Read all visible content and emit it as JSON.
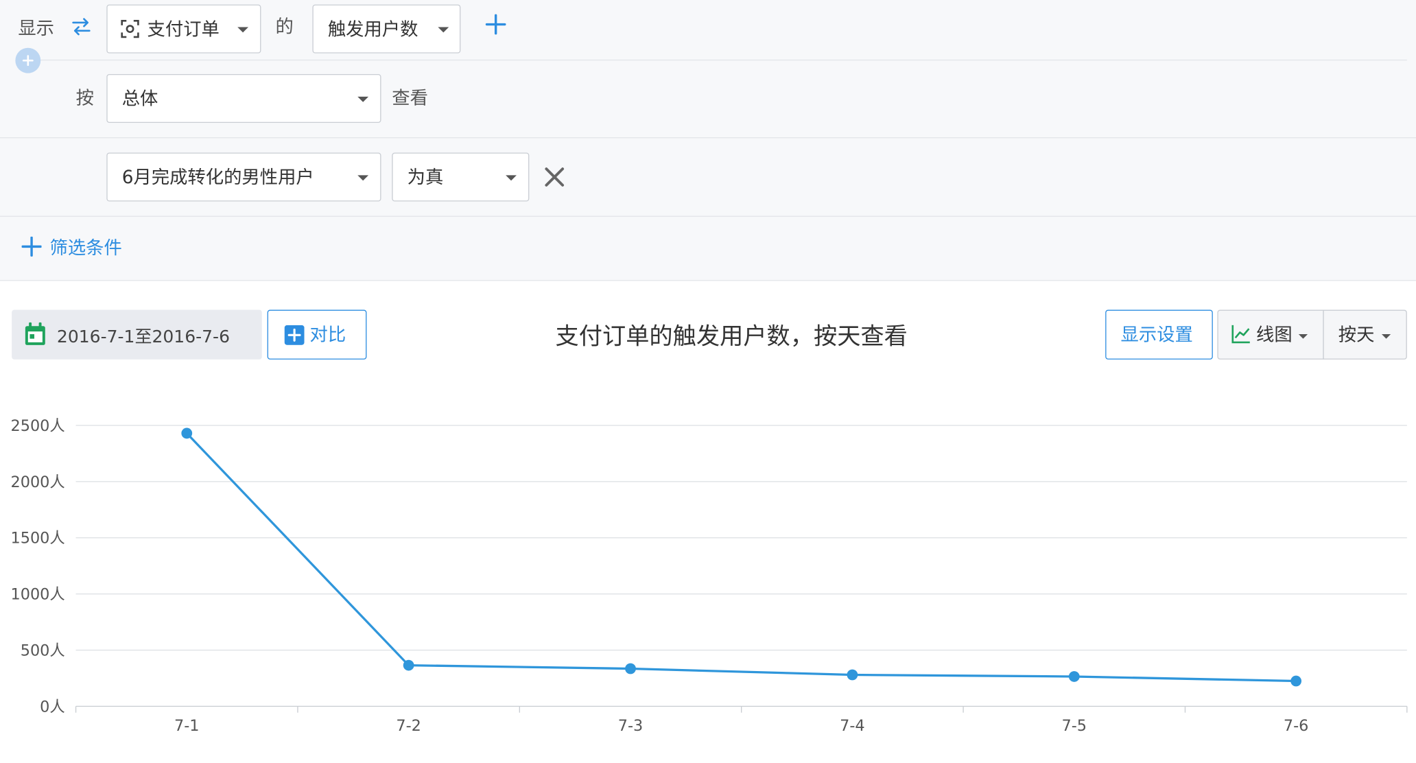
{
  "query": {
    "show_label": "显示",
    "event_select": "支付订单",
    "of_label": "的",
    "metric_select": "触发用户数",
    "by_label": "按",
    "group_select": "总体",
    "view_label": "查看"
  },
  "filter": {
    "condition_select": "6月完成转化的男性用户",
    "value_select": "为真",
    "add_filter_label": "筛选条件"
  },
  "toolbar": {
    "date_range": "2016-7-1至2016-7-6",
    "compare_label": "对比",
    "display_settings_label": "显示设置",
    "chart_type_label": "线图",
    "granularity_label": "按天"
  },
  "colors": {
    "accent": "#2d8de0",
    "calendar": "#1fa35c",
    "line": "#2f96db",
    "grid": "#dcdfe3"
  },
  "chart_data": {
    "type": "line",
    "title": "支付订单的触发用户数，按天查看",
    "categories": [
      "7-1",
      "7-2",
      "7-3",
      "7-4",
      "7-5",
      "7-6"
    ],
    "series": [
      {
        "values": [
          2430,
          365,
          335,
          280,
          265,
          225
        ]
      }
    ],
    "y_ticks": [
      "0人",
      "500人",
      "1000人",
      "1500人",
      "2000人",
      "2500人"
    ],
    "ylim": [
      0,
      2500
    ],
    "grid": true,
    "legend": "none"
  }
}
